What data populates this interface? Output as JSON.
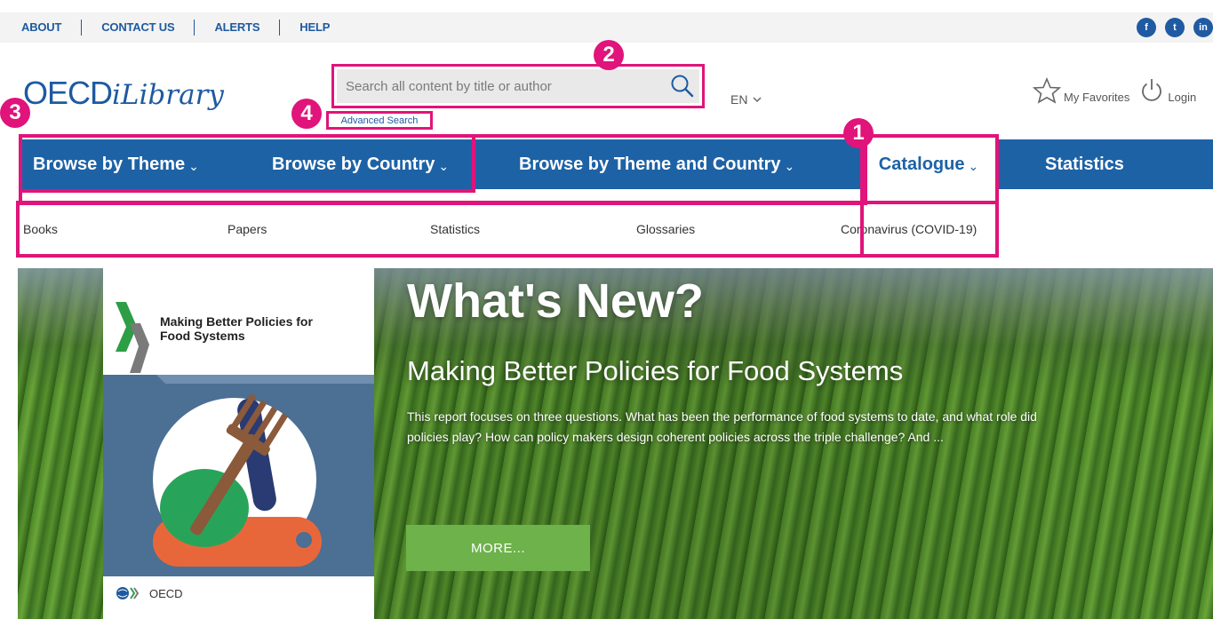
{
  "utility_nav": {
    "links": [
      "ABOUT",
      "CONTACT US",
      "ALERTS",
      "HELP"
    ],
    "socials": [
      "f",
      "t",
      "in"
    ]
  },
  "header": {
    "logo_main": "OECD",
    "logo_sub": "iLibrary",
    "search_placeholder": "Search all content by title or author",
    "advanced_search": "Advanced Search",
    "language": "EN",
    "favorites": "My Favorites",
    "login": "Login"
  },
  "main_nav": {
    "items": [
      {
        "label": "Browse by Theme",
        "chevron": "⌄"
      },
      {
        "label": "Browse by Country",
        "chevron": "⌄"
      },
      {
        "label": "Browse by Theme and Country",
        "chevron": "⌄"
      },
      {
        "label": "Catalogue",
        "chevron": "⌄"
      },
      {
        "label": "Statistics",
        "chevron": ""
      }
    ],
    "active": "Catalogue"
  },
  "catalogue_menu": {
    "items": [
      "Books",
      "Papers",
      "Statistics",
      "Glossaries",
      "Coronavirus (COVID-19)"
    ]
  },
  "annotations": {
    "badges": [
      "1",
      "2",
      "3",
      "4"
    ]
  },
  "hero": {
    "heading": "What's New?",
    "title": "Making Better Policies for Food Systems",
    "description": "This report focuses on three questions. What has been the performance of food systems to date, and what role did policies play? How can policy makers design coherent policies across the triple challenge? And ...",
    "more_label": "MORE...",
    "cover_title": "Making Better Policies for Food Systems",
    "cover_publisher": "OECD"
  },
  "colors": {
    "brand_blue": "#1e62a6",
    "highlight_pink": "#e0147a",
    "more_green": "#6db24a"
  }
}
